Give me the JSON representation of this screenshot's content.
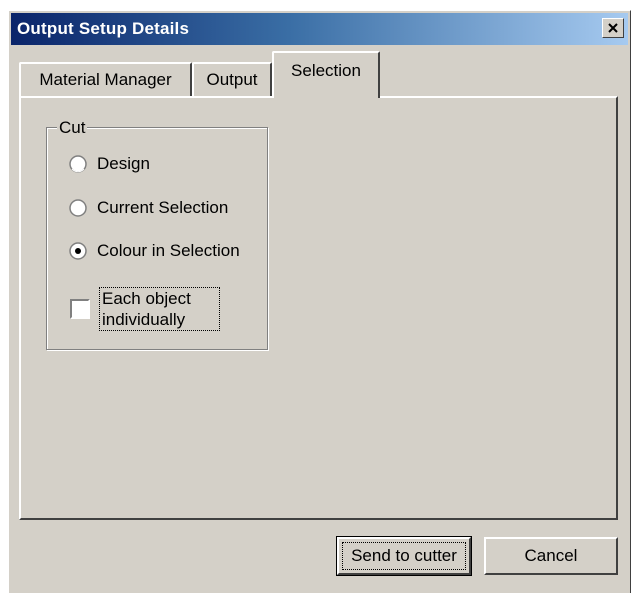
{
  "window": {
    "title": "Output Setup Details",
    "close_symbol": "×"
  },
  "tabs": [
    {
      "label": "Material Manager",
      "selected": false
    },
    {
      "label": "Output",
      "selected": false
    },
    {
      "label": "Selection",
      "selected": true
    }
  ],
  "cut_group": {
    "legend": "Cut",
    "options": [
      {
        "label": "Design",
        "checked": false
      },
      {
        "label": "Current Selection",
        "checked": false
      },
      {
        "label": "Colour in Selection",
        "checked": true
      }
    ],
    "checkbox": {
      "label_line1": "Each object",
      "label_line2": "individually",
      "checked": false
    }
  },
  "buttons": {
    "send_label": "Send to cutter",
    "cancel_label": "Cancel"
  },
  "colors": {
    "title_gradient_start": "#0a246a",
    "title_gradient_end": "#a6caf0",
    "face": "#d4d0c8"
  }
}
